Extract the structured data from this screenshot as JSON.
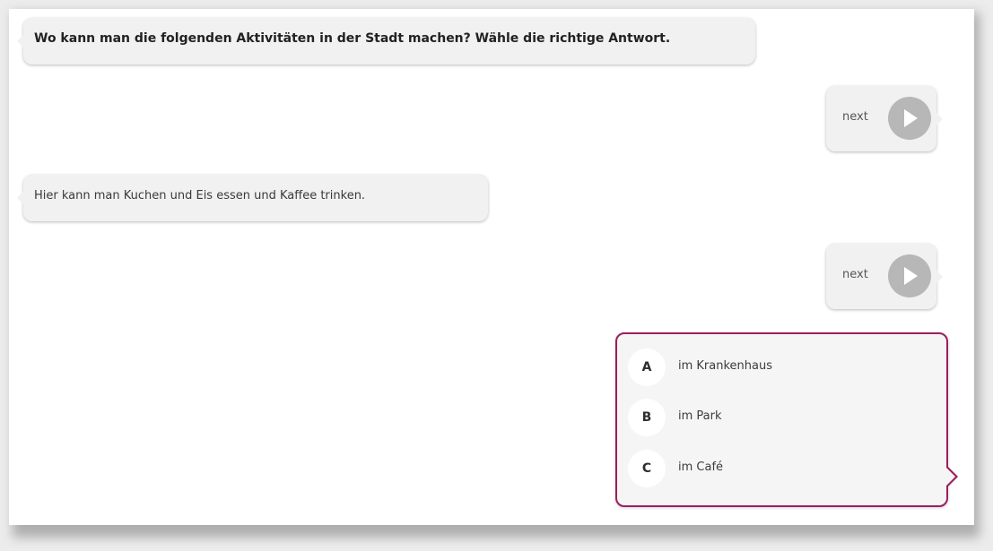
{
  "exercise": {
    "question": "Wo kann man die folgenden Aktivitäten in der Stadt machen? Wähle die richtige Antwort.",
    "prompt": "Hier kann man Kuchen und Eis essen und Kaffee trinken."
  },
  "controls": {
    "next_label": "next",
    "next_icon": "play-icon"
  },
  "answers": {
    "options": [
      {
        "letter": "A",
        "text": "im Krankenhaus"
      },
      {
        "letter": "B",
        "text": "im Park"
      },
      {
        "letter": "C",
        "text": "im Café"
      }
    ]
  },
  "colors": {
    "bubble": "#f1f1f1",
    "accent": "#9c1f5e",
    "play_button": "#b7b7b7"
  }
}
